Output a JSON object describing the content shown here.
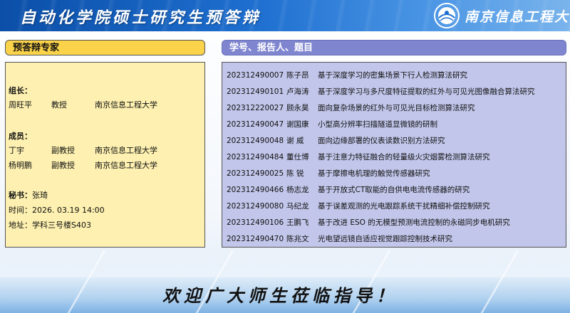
{
  "header": {
    "title": "自动化学院硕士研究生预答辩",
    "university_logo_text": "南京信息工程大学"
  },
  "left_panel": {
    "title": "预答辩专家",
    "leader_label": "组长：",
    "leader": {
      "name": "周旺平",
      "rank": "教授",
      "org": "南京信息工程大学"
    },
    "members_label": "成员：",
    "members": [
      {
        "name": "丁宇",
        "rank": "副教授",
        "org": "南京信息工程大学"
      },
      {
        "name": "杨明鹏",
        "rank": "副教授",
        "org": "南京信息工程大学"
      }
    ],
    "secretary_label": "秘书：",
    "secretary": "张琦",
    "time_label": "时间：",
    "time": "2026. 03.19  14:00",
    "place_label": "地址：",
    "place": "学科三号楼S403"
  },
  "right_panel": {
    "title": "学号、报告人、题目",
    "rows": [
      {
        "id": "202312490007",
        "name": "陈子昂",
        "topic": "基于深度学习的密集场景下行人检测算法研究"
      },
      {
        "id": "202312490101",
        "name": "卢海涛",
        "topic": "基于深度学习与多尺度特征提取的红外与可见光图像融合算法研究"
      },
      {
        "id": "202312220027",
        "name": "顾永昊",
        "topic": "面向复杂场景的红外与可见光目标检测算法研究"
      },
      {
        "id": "202312490047",
        "name": "谢国康",
        "topic": "小型高分辨率扫描隧道显微镜的研制"
      },
      {
        "id": "202312490048",
        "name": "谢   威",
        "topic": "面向边缘部署的仪表读数识别方法研究"
      },
      {
        "id": "202312490484",
        "name": "董仕博",
        "topic": "基于注意力特征融合的轻量级火灾烟雾检测算法研究"
      },
      {
        "id": "202312490025",
        "name": "陈   锐",
        "topic": "基于摩擦电机理的触觉传感器研究"
      },
      {
        "id": "202312490466",
        "name": "杨志龙",
        "topic": "基于开放式CT取能的自供电电流传感器的研究"
      },
      {
        "id": "202312490080",
        "name": "马纪龙",
        "topic": "基于误差观测的光电跟踪系统干扰精细补偿控制研究"
      },
      {
        "id": "202312490106",
        "name": "王鹏飞",
        "topic": "基于改进 ESO 的无模型预测电流控制的永磁同步电机研究"
      },
      {
        "id": "202312490470",
        "name": "陈兆文",
        "topic": "光电望远镜自适应视觉跟踪控制技术研究"
      }
    ]
  },
  "footer": {
    "welcome": "欢迎广大师生莅临指导！"
  },
  "colors": {
    "header_blue": "#1e6fd0",
    "left_title_bg": "#fbd34a",
    "left_box_bg": "#fdf0b0",
    "right_title_bg": "#7f86cf",
    "right_box_bg": "#c2c6ea"
  }
}
